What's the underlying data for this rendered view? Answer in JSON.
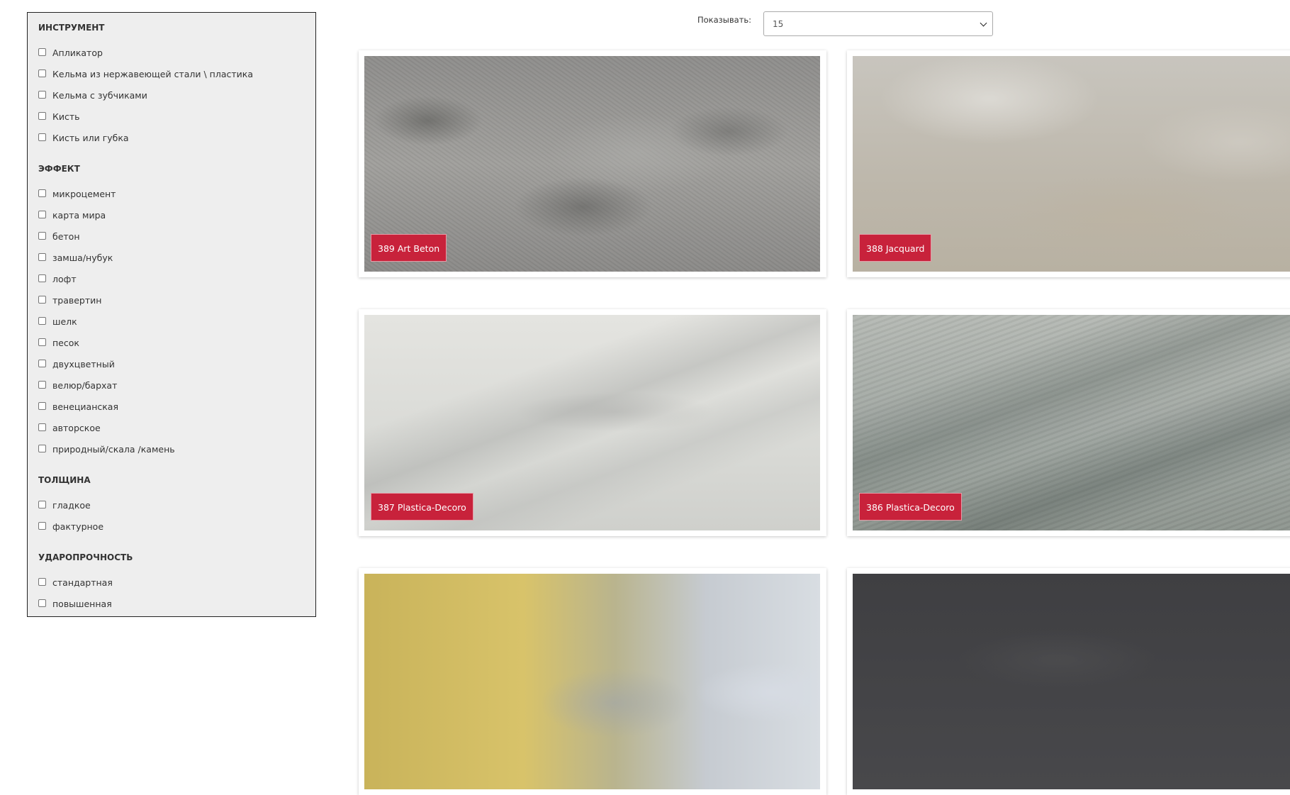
{
  "filters": [
    {
      "title": "ИНСТРУМЕНТ",
      "options": [
        "Апликатор",
        "Кельма из нержавеющей стали \\ пластика",
        "Кельма с зубчиками",
        "Кисть",
        "Кисть или губка"
      ]
    },
    {
      "title": "ЭФФЕКТ",
      "options": [
        "микроцемент",
        "карта мира",
        "бетон",
        "замша/нубук",
        "лофт",
        "травертин",
        "шелк",
        "песок",
        "двухцветный",
        "велюр/бархат",
        "венецианская",
        "авторское",
        "природный/скала /камень"
      ]
    },
    {
      "title": "ТОЛЩИНА",
      "options": [
        "гладкое",
        "фактурное"
      ]
    },
    {
      "title": "УДАРОПРОЧНОСТЬ",
      "options": [
        "стандартная",
        "повышенная"
      ]
    }
  ],
  "per_page": {
    "label": "Показывать:",
    "value": "15"
  },
  "products": [
    {
      "label": "389 Art Beton"
    },
    {
      "label": "388 Jacquard"
    },
    {
      "label": "387 Plastica-Decoro"
    },
    {
      "label": "386 Plastica-Decoro"
    },
    {
      "label": ""
    },
    {
      "label": ""
    }
  ],
  "colors": {
    "badge": "#c8223b",
    "sidebar_bg": "#eeeeee"
  }
}
